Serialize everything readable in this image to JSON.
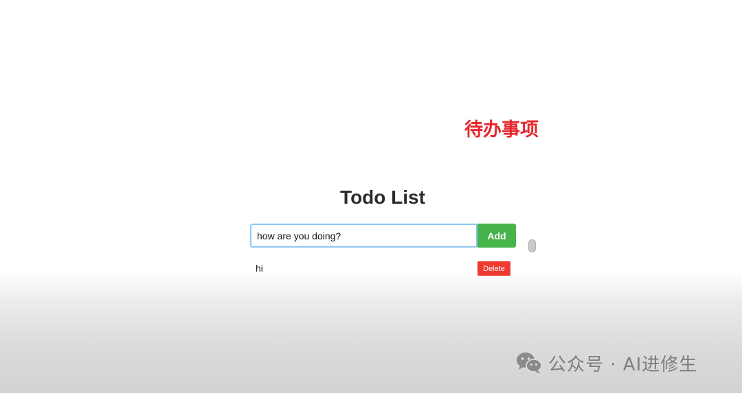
{
  "annotation": {
    "text": "待办事项",
    "color": "#e8262b"
  },
  "app": {
    "title": "Todo List",
    "input": {
      "value": "how are you doing?",
      "placeholder": ""
    },
    "add_label": "Add",
    "items": [
      {
        "text": "hi",
        "delete_label": "Delete"
      }
    ]
  },
  "colors": {
    "add_button": "#46b34b",
    "delete_button": "#ee3a31",
    "input_focus_border": "#8ec6f0"
  },
  "watermark": {
    "icon": "wechat-icon",
    "text": "公众号 · AI进修生"
  }
}
